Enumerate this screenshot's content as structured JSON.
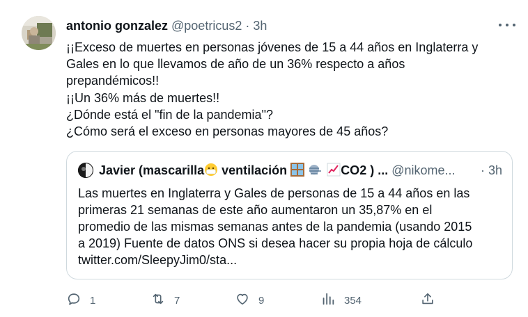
{
  "tweet": {
    "author_name": "antonio gonzalez",
    "author_handle": "@poetricus2",
    "separator": "·",
    "time": "3h",
    "lines": [
      "¡¡Exceso de muertes en personas jóvenes de 15 a 44 años en Inglaterra y",
      "Gales en lo que llevamos de año de un 36% respecto a años",
      "prepandémicos!!",
      "¡¡Un 36% más de muertes!!",
      "¿Dónde está el \"fin de la pandemia\"?",
      "¿Cómo será el exceso en personas mayores de 45 años?"
    ]
  },
  "quote": {
    "name_prefix": "Javier (mascarilla",
    "name_middle": " ventilación ",
    "name_suffix": "CO2 ) ...",
    "handle": "@nikome...",
    "separator": "·",
    "time": "3h",
    "lines": [
      "Las muertes en Inglaterra y Gales de personas de 15 a 44 años en las",
      "primeras 21 semanas de este año aumentaron un 35,87% en el",
      "promedio de las mismas semanas antes de la pandemia (usando 2015",
      "a 2019)  Fuente de datos ONS si desea hacer su propia hoja de cálculo",
      "twitter.com/SleepyJim0/sta..."
    ]
  },
  "actions": {
    "reply_count": "1",
    "retweet_count": "7",
    "like_count": "9",
    "views_count": "354"
  },
  "colors": {
    "text": "#0f1419",
    "secondary": "#536471",
    "border": "#cfd9de"
  }
}
